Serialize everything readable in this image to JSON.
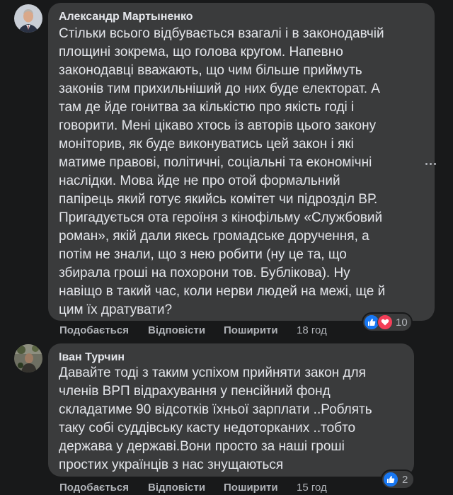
{
  "comments": [
    {
      "author": "Александр Мартыненко",
      "lines": [
        "Стільки всього відбувається взагалі і в законодавчій",
        "площині зокрема, що голова кругом. Напевно",
        "законодавці вважають, що чим більше приймуть",
        "законів тим прихильніший до них буде електорат. А",
        "там де йде гонитва за кількістю про якість годі і",
        "говорити. Мені цікаво хтось із авторів цього закону",
        "моніторив, як буде виконуватись цей закон і які",
        "матиме правові, політичні, соціальні та економічні",
        "наслідки. Мова йде не про отой формальний",
        "папірець який готує якийсь комітет чи підрозділ ВР.",
        "Пригадується ота героїня з кінофільму «Службовий",
        "роман», якій дали якесь громадське доручення, а",
        "потім не знали, що з нею робити (ну це та, що",
        "збирала гроші на похорони тов. Бублікова). Ну",
        "навіщо в такий час, коли нерви людей на межі, ще й",
        "цим їх дратувати?"
      ],
      "actions": {
        "like": "Подобається",
        "reply": "Відповісти",
        "share": "Поширити",
        "time": "18 год"
      },
      "reactions": {
        "icons": [
          "like-icon",
          "love-icon"
        ],
        "count": "10"
      }
    },
    {
      "author": "Іван Турчин",
      "lines": [
        "Давайте тоді з таким успіхом прийняти закон для",
        "членів ВРП відрахування у пенсійний фонд",
        "складатиме 90 відсотків їхньої зарплати ..Роблять",
        "таку собі суддівську касту недоторканих ..тобто",
        "держава у державі.Вони просто за наші гроші",
        "простих українців з нас знущаються"
      ],
      "actions": {
        "like": "Подобається",
        "reply": "Відповісти",
        "share": "Поширити",
        "time": "15 год"
      },
      "reactions": {
        "icons": [
          "like-icon"
        ],
        "count": "2"
      }
    }
  ],
  "more_menu_icon": "more-options-icon",
  "colors": {
    "background": "#18191a",
    "bubble": "#3a3b3c",
    "text": "#e4e6eb",
    "secondary": "#b0b3b8",
    "like": "#1877f2",
    "love": "#f33e58"
  }
}
